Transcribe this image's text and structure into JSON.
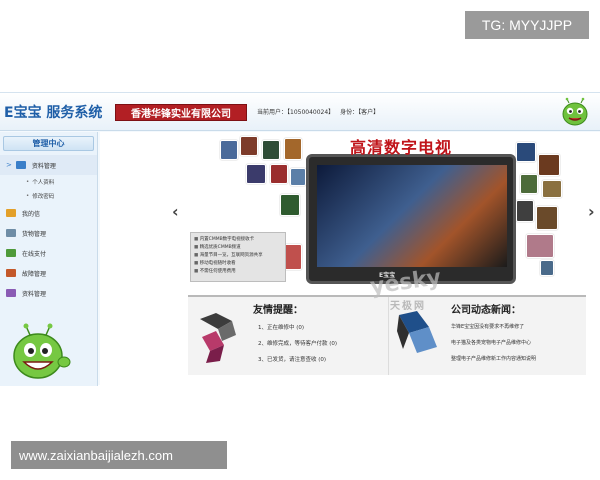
{
  "overlay": {
    "top_watermark": "TG: MYYJJPP",
    "bottom_watermark": "www.zaixianbaijialezh.com"
  },
  "header": {
    "brand": "E宝宝 服务系统",
    "company": "香港华锋实业有限公司",
    "current_user_label": "当前用户：【1050040024】",
    "role_label": "身份：【客户】"
  },
  "sidebar": {
    "title": "管理中心",
    "items": [
      {
        "label": "资料管理",
        "icon": "folder-icon",
        "color": "#3a7fc9"
      },
      {
        "label": "我的信",
        "icon": "mail-icon",
        "color": "#e3a02a"
      },
      {
        "label": "货物管理",
        "icon": "box-icon",
        "color": "#6f8da6"
      },
      {
        "label": "在线支付",
        "icon": "payment-icon",
        "color": "#4f9a3a"
      },
      {
        "label": "故障管理",
        "icon": "wrench-icon",
        "color": "#c3582a"
      },
      {
        "label": "资料管理",
        "icon": "doc-icon",
        "color": "#8a5bb4"
      }
    ],
    "sub_items": [
      "个人资料",
      "修改密码"
    ]
  },
  "banner": {
    "title": "高清数字电视",
    "tv_logo": "E宝宝",
    "features": [
      "内置CMMB数字电视接收卡",
      "精选优质CMMB频道",
      "海量节目一览，互联网资源共享",
      "移动电视随时收看",
      "不需任何使用费用"
    ],
    "prev_arrow": "‹",
    "next_arrow": "›"
  },
  "notices": {
    "title": "友情提醒：",
    "items": [
      "1、正在维修中 (0)",
      "2、维修完成，等待客户付款 (0)",
      "3、已发货，请注意查收 (0)"
    ]
  },
  "news": {
    "title": "公司动态新闻：",
    "items": [
      "华锋E宝宝因没有要求不再维修了",
      "电子猫及各类宠物电子产品维修中心",
      "整理电子产品维修新工作内容通知说明"
    ]
  },
  "site_watermark": {
    "main": "yesky",
    "sub": "天极网"
  }
}
